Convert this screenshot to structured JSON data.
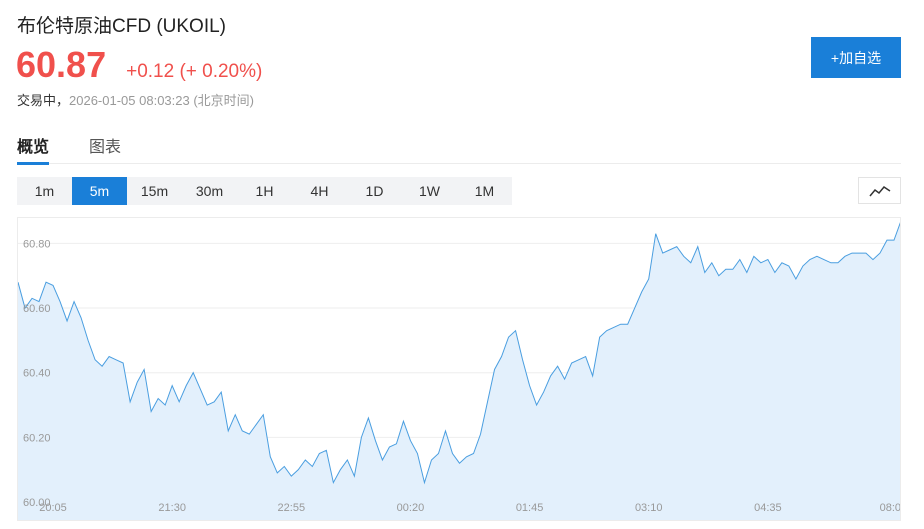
{
  "header": {
    "title": "布伦特原油CFD  (UKOIL)",
    "price": "60.87",
    "change": "+0.12 (+ 0.20%)",
    "status_label": "交易中，",
    "status_time": "2026-01-05 08:03:23 (北京时间)",
    "add_label": "+加自选"
  },
  "colors": {
    "accent": "#1a7fd8",
    "up": "#f0504c",
    "line": "#4a9ee0",
    "fill": "#e3f0fc"
  },
  "tabs": [
    {
      "label": "概览",
      "active": true
    },
    {
      "label": "图表",
      "active": false
    }
  ],
  "periods": [
    {
      "label": "1m",
      "active": false
    },
    {
      "label": "5m",
      "active": true
    },
    {
      "label": "15m",
      "active": false
    },
    {
      "label": "30m",
      "active": false
    },
    {
      "label": "1H",
      "active": false
    },
    {
      "label": "4H",
      "active": false
    },
    {
      "label": "1D",
      "active": false
    },
    {
      "label": "1W",
      "active": false
    },
    {
      "label": "1M",
      "active": false
    }
  ],
  "chart_type_icon": "line-chart-icon",
  "chart_data": {
    "type": "area",
    "ylim": [
      60.0,
      60.86
    ],
    "yticks": [
      {
        "value": 60.0,
        "label": "60.00"
      },
      {
        "value": 60.2,
        "label": "60.20"
      },
      {
        "value": 60.4,
        "label": "60.40"
      },
      {
        "value": 60.6,
        "label": "60.60"
      },
      {
        "value": 60.8,
        "label": "60.80"
      }
    ],
    "xticks": [
      {
        "index": 5,
        "label": "20:05"
      },
      {
        "index": 22,
        "label": "21:30"
      },
      {
        "index": 39,
        "label": "22:55"
      },
      {
        "index": 56,
        "label": "00:20"
      },
      {
        "index": 73,
        "label": "01:45"
      },
      {
        "index": 90,
        "label": "03:10"
      },
      {
        "index": 107,
        "label": "04:35"
      },
      {
        "index": 124,
        "label": "08:0"
      }
    ],
    "values": [
      60.68,
      60.6,
      60.63,
      60.62,
      60.68,
      60.67,
      60.62,
      60.56,
      60.62,
      60.57,
      60.5,
      60.44,
      60.42,
      60.45,
      60.44,
      60.43,
      60.31,
      60.37,
      60.41,
      60.28,
      60.32,
      60.3,
      60.36,
      60.31,
      60.36,
      60.4,
      60.35,
      60.3,
      60.31,
      60.34,
      60.22,
      60.27,
      60.22,
      60.21,
      60.24,
      60.27,
      60.14,
      60.09,
      60.11,
      60.08,
      60.1,
      60.13,
      60.11,
      60.15,
      60.16,
      60.06,
      60.1,
      60.13,
      60.08,
      60.2,
      60.26,
      60.19,
      60.13,
      60.17,
      60.18,
      60.25,
      60.19,
      60.15,
      60.06,
      60.13,
      60.15,
      60.22,
      60.15,
      60.12,
      60.14,
      60.15,
      60.21,
      60.31,
      60.41,
      60.45,
      60.51,
      60.53,
      60.44,
      60.36,
      60.3,
      60.34,
      60.39,
      60.42,
      60.38,
      60.43,
      60.44,
      60.45,
      60.39,
      60.51,
      60.53,
      60.54,
      60.55,
      60.55,
      60.6,
      60.65,
      60.69,
      60.83,
      60.77,
      60.78,
      60.79,
      60.76,
      60.74,
      60.79,
      60.71,
      60.74,
      60.7,
      60.72,
      60.72,
      60.75,
      60.71,
      60.76,
      60.74,
      60.75,
      60.71,
      60.74,
      60.73,
      60.69,
      60.73,
      60.75,
      60.76,
      60.75,
      60.74,
      60.74,
      60.76,
      60.77,
      60.77,
      60.77,
      60.75,
      60.77,
      60.81,
      60.81,
      60.87
    ]
  }
}
